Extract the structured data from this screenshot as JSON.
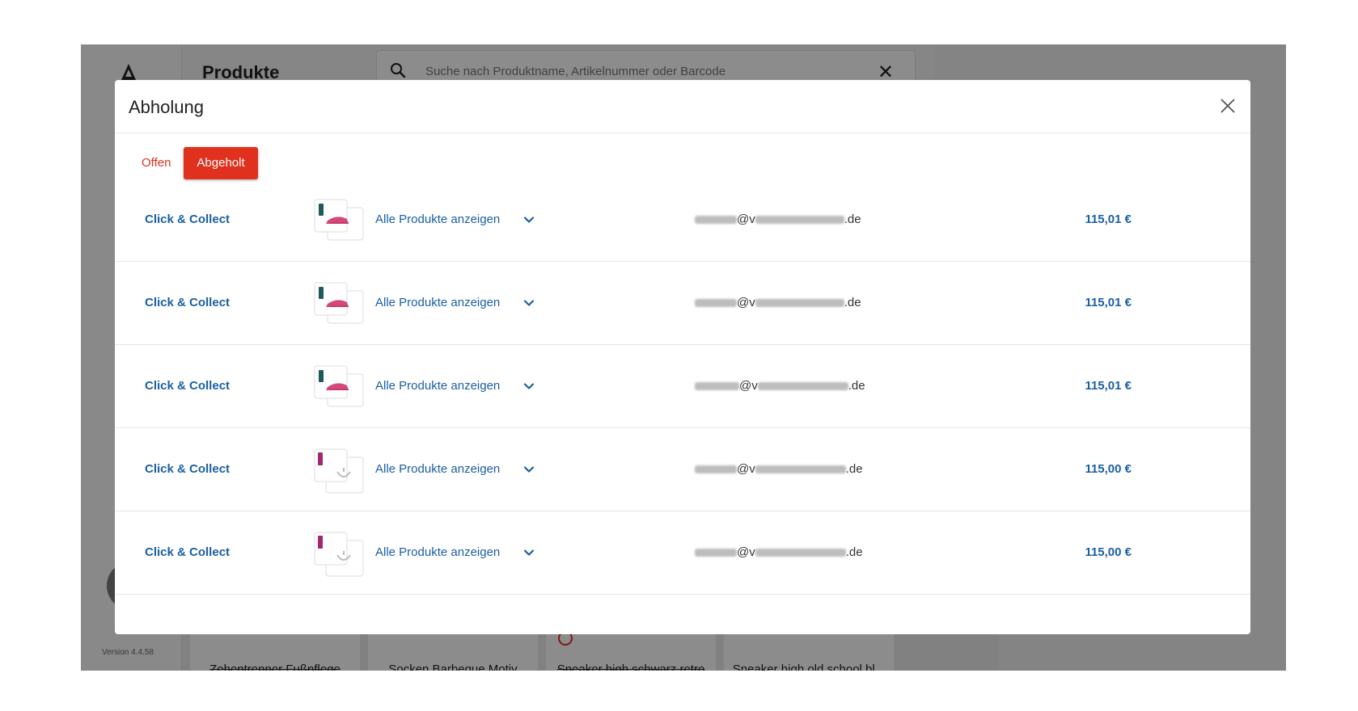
{
  "app": {
    "title": "Produkte",
    "search_placeholder": "Suche nach Produktname, Artikelnummer oder Barcode",
    "version": "Version 4.4.58",
    "tiles": [
      {
        "name": "Zehentrenner Fußpflege",
        "struck": true
      },
      {
        "name": "Socken Barbeque Motiv",
        "struck": false
      },
      {
        "name": "Sneaker high schwarz retro",
        "struck": true
      },
      {
        "name": "Sneaker high old school bl...",
        "struck": false
      }
    ]
  },
  "modal": {
    "title": "Abholung",
    "tabs": [
      {
        "label": "Offen",
        "active": false
      },
      {
        "label": "Abgeholt",
        "active": true
      }
    ],
    "orders": [
      {
        "type": "Click & Collect",
        "show_all": "Alle Produkte anzeigen",
        "email_at": "@v",
        "email_tld": ".de",
        "price": "115,01 €",
        "thumb": "shoe"
      },
      {
        "type": "Click & Collect",
        "show_all": "Alle Produkte anzeigen",
        "email_at": "@v",
        "email_tld": ".de",
        "price": "115,01 €",
        "thumb": "shoe"
      },
      {
        "type": "Click & Collect",
        "show_all": "Alle Produkte anzeigen",
        "email_at": "@v",
        "email_tld": ".de",
        "price": "115,01 €",
        "thumb": "shoe"
      },
      {
        "type": "Click & Collect",
        "show_all": "Alle Produkte anzeigen",
        "email_at": "@v",
        "email_tld": ".de",
        "price": "115,00 €",
        "thumb": "bag"
      },
      {
        "type": "Click & Collect",
        "show_all": "Alle Produkte anzeigen",
        "email_at": "@v",
        "email_tld": ".de",
        "price": "115,00 €",
        "thumb": "bag"
      }
    ]
  },
  "colors": {
    "accent": "#e0301e",
    "link": "#1b5fa3"
  },
  "icons": {
    "search": "search-icon",
    "close": "close-icon",
    "chevron": "chevron-down-icon"
  }
}
